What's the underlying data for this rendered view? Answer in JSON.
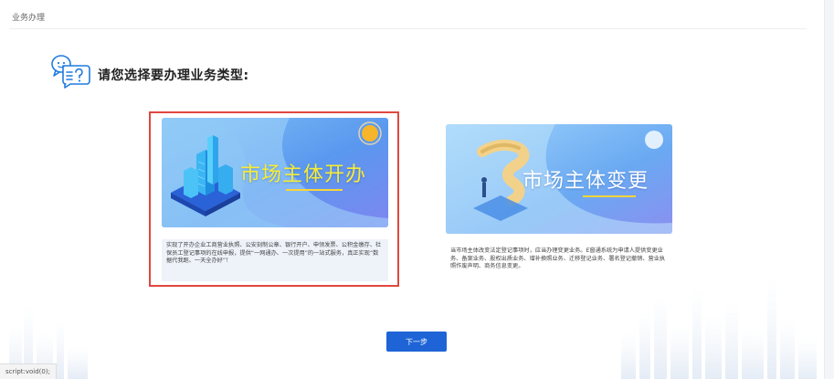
{
  "breadcrumb": {
    "label": "业务办理"
  },
  "prompt": {
    "title": "请您选择要办理业务类型:"
  },
  "cards": [
    {
      "title": "市场主体开办",
      "description": "实现了开办企业工商营业执照、公安刻制公章、银行开户、申领发票、公积金缴存、社保员工登记事项的在线申报，提供“一网通办、一次提用”的一站式服务，真正实现“数据代我跑、一天全办好”！"
    },
    {
      "title": "市场主体变更",
      "description": "当市场主体改变法定登记事项时，应当办理变更业务。E窗通系统为申请人提供变更业务、备案业务、股权出质业务、增补换照业务、迁移登记业务、署名登记撤销、营业执照作废声明、商务信息变更。"
    }
  ],
  "next_button": {
    "label": "下一步"
  },
  "status_bar": {
    "text": "script:void(0);"
  },
  "colors": {
    "accent": "#1f64d6",
    "selected_border": "#e0473f",
    "banner_title_highlight": "#f7ec35"
  }
}
